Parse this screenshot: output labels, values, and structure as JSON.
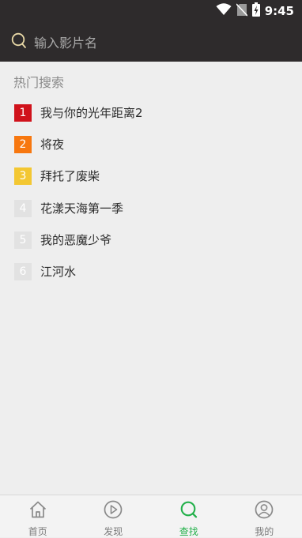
{
  "status_bar": {
    "time": "9:45",
    "icons": [
      "wifi-icon",
      "no-sim-icon",
      "battery-charging-icon"
    ]
  },
  "search": {
    "placeholder": "输入影片名",
    "value": "",
    "icon": "search-icon"
  },
  "hot_search": {
    "title": "热门搜索",
    "items": [
      {
        "rank": "1",
        "title": "我与你的光年距离2",
        "badge_color": "#d0121b"
      },
      {
        "rank": "2",
        "title": "将夜",
        "badge_color": "#f7770f"
      },
      {
        "rank": "3",
        "title": "拜托了废柴",
        "badge_color": "#f3c732"
      },
      {
        "rank": "4",
        "title": "花漾天海第一季",
        "badge_color": "#e2e2e2"
      },
      {
        "rank": "5",
        "title": "我的恶魔少爷",
        "badge_color": "#e2e2e2"
      },
      {
        "rank": "6",
        "title": "江河水",
        "badge_color": "#e2e2e2"
      }
    ]
  },
  "tab_bar": {
    "tabs": [
      {
        "label": "首页",
        "icon": "home-icon",
        "active": false
      },
      {
        "label": "发现",
        "icon": "play-circle-icon",
        "active": false
      },
      {
        "label": "查找",
        "icon": "search-icon",
        "active": true
      },
      {
        "label": "我的",
        "icon": "user-icon",
        "active": false
      }
    ]
  },
  "colors": {
    "header_bg": "#2e2b2c",
    "page_bg": "#eeeeee",
    "accent": "#22b04a"
  }
}
